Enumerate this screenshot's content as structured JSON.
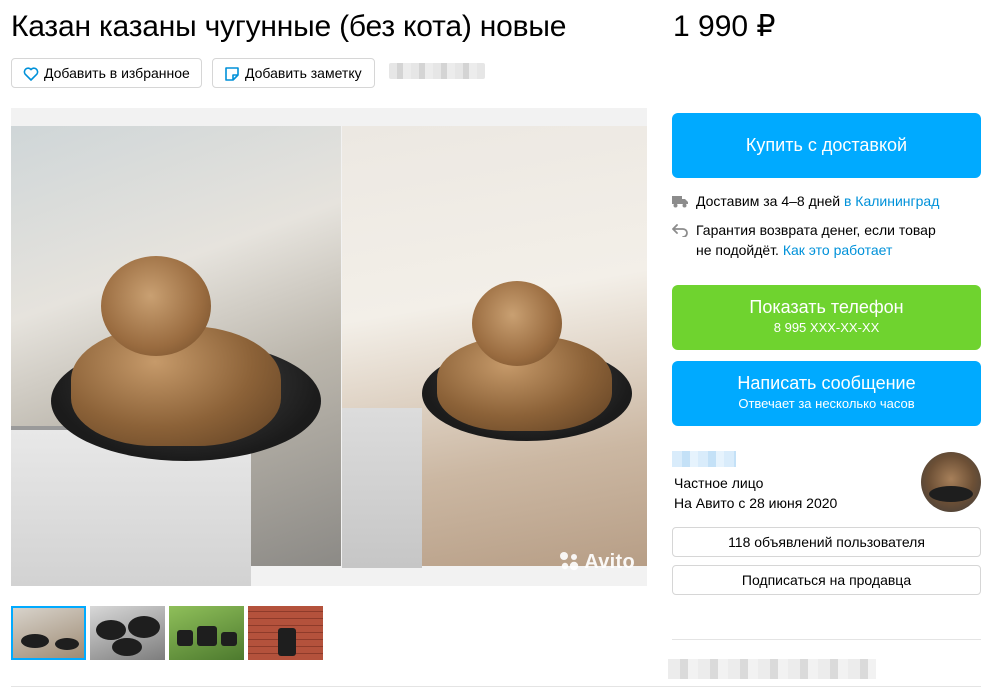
{
  "listing": {
    "title": "Казан казаны чугунные (без кота) новые",
    "price": "1 990 ₽"
  },
  "actions": {
    "favorite_label": "Добавить в избранное",
    "note_label": "Добавить заметку"
  },
  "gallery": {
    "watermark": "Avito",
    "thumbnail_count": 4,
    "selected_thumbnail": 0
  },
  "purchase": {
    "buy_label": "Купить с доставкой",
    "delivery_text": "Доставим за 4–8 дней ",
    "delivery_city_link": "в Калининград",
    "guarantee_line1": "Гарантия возврата денег, если товар",
    "guarantee_line2": "не подойдёт. ",
    "guarantee_link": "Как это работает"
  },
  "contact": {
    "phone_label": "Показать телефон",
    "phone_number": "8 995 XXX-XX-XX",
    "message_label": "Написать сообщение",
    "message_sub": "Отвечает за несколько часов"
  },
  "seller": {
    "type": "Частное лицо",
    "since": "На Авито с 28 июня 2020",
    "ads_button": "118 объявлений пользователя",
    "subscribe_button": "Подписаться на продавца"
  },
  "colors": {
    "primary_blue": "#00aaff",
    "phone_green": "#6fd32f",
    "link_blue": "#0091d9"
  },
  "icons": [
    "heart-icon",
    "note-icon",
    "truck-icon",
    "return-arrow-icon",
    "avito-logo-icon"
  ]
}
